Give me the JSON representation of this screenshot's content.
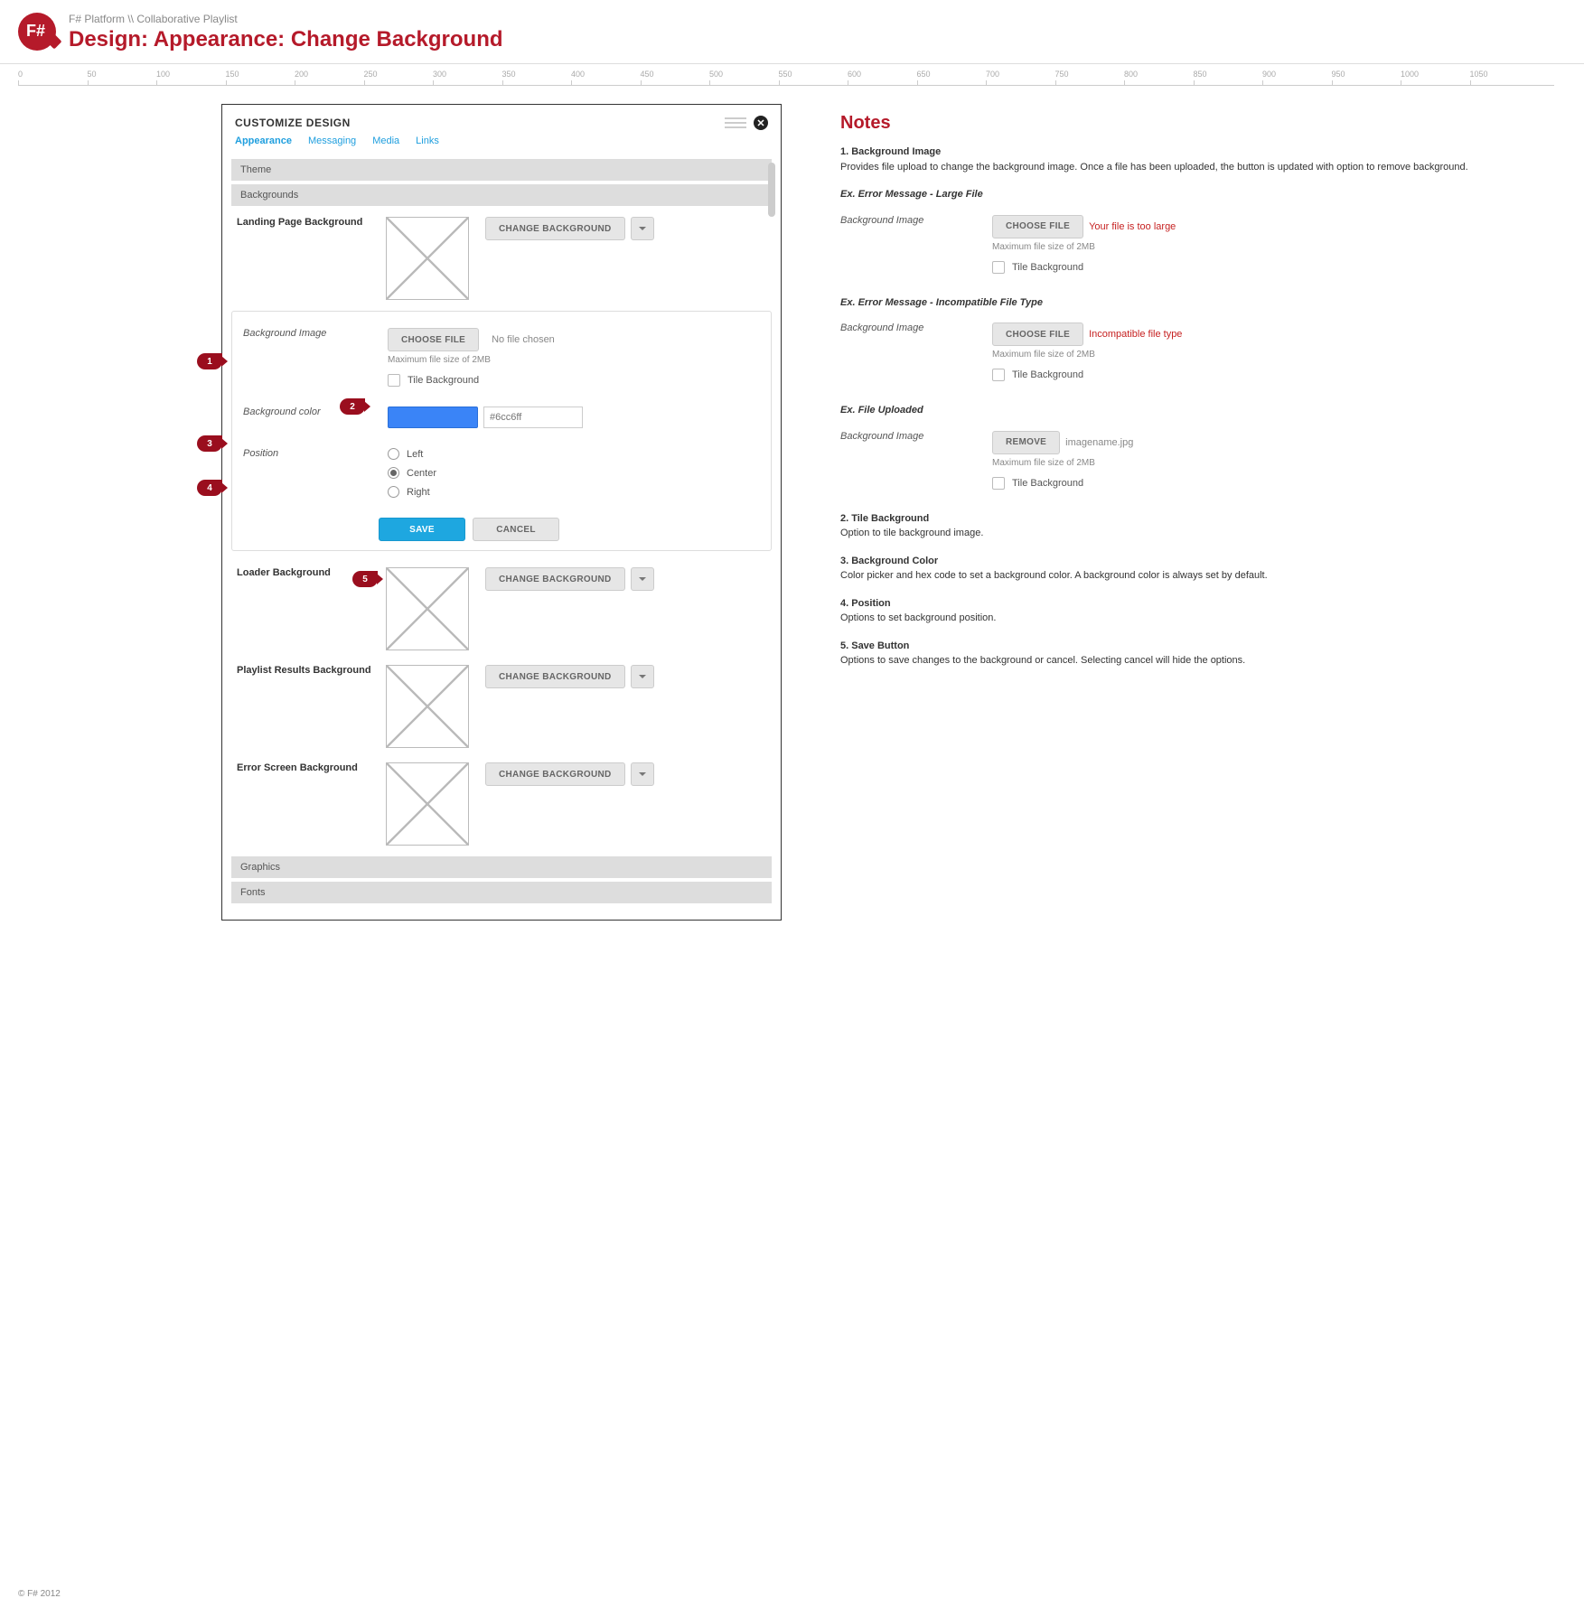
{
  "header": {
    "breadcrumb": "F# Platform \\\\ Collaborative Playlist",
    "title": "Design: Appearance: Change Background",
    "logo_text": "F#"
  },
  "ruler": {
    "ticks": [
      "0",
      "50",
      "100",
      "150",
      "200",
      "250",
      "300",
      "350",
      "400",
      "450",
      "500",
      "550",
      "600",
      "650",
      "700",
      "750",
      "800",
      "850",
      "900",
      "950",
      "1000",
      "1050"
    ]
  },
  "panel": {
    "title": "CUSTOMIZE DESIGN",
    "tabs": [
      {
        "label": "Appearance",
        "active": true
      },
      {
        "label": "Messaging",
        "active": false
      },
      {
        "label": "Media",
        "active": false
      },
      {
        "label": "Links",
        "active": false
      }
    ],
    "sections": {
      "theme": "Theme",
      "backgrounds": "Backgrounds",
      "graphics": "Graphics",
      "fonts": "Fonts"
    },
    "rows": {
      "landing": {
        "label": "Landing Page Background",
        "btn": "CHANGE BACKGROUND"
      },
      "loader": {
        "label": "Loader Background",
        "btn": "CHANGE BACKGROUND"
      },
      "playlist": {
        "label": "Playlist Results Background",
        "btn": "CHANGE BACKGROUND"
      },
      "error": {
        "label": "Error Screen Background",
        "btn": "CHANGE BACKGROUND"
      }
    },
    "expanded": {
      "bg_image_label": "Background Image",
      "choose_file": "Choose File",
      "no_file": "No file chosen",
      "max_hint": "Maximum file size of 2MB",
      "tile_label": "Tile Background",
      "bg_color_label": "Background color",
      "hex_placeholder": "#6cc6ff",
      "position_label": "Position",
      "pos_left": "Left",
      "pos_center": "Center",
      "pos_right": "Right",
      "save": "SAVE",
      "cancel": "CANCEL"
    }
  },
  "markers": {
    "m1": "1",
    "m2": "2",
    "m3": "3",
    "m4": "4",
    "m5": "5"
  },
  "notes": {
    "title": "Notes",
    "n1_title": "1. Background Image",
    "n1_body": "Provides file upload to change the background image. Once a file has been uploaded, the button is updated with option to remove background.",
    "ex_large_title": "Ex. Error Message - Large File",
    "ex_large_label": "Background Image",
    "ex_large_btn": "Choose File",
    "ex_large_err": "Your file is too large",
    "ex_large_hint": "Maximum file size of 2MB",
    "ex_large_tile": "Tile Background",
    "ex_type_title": "Ex. Error Message - Incompatible File Type",
    "ex_type_label": "Background Image",
    "ex_type_btn": "Choose File",
    "ex_type_err": "Incompatible file type",
    "ex_type_hint": "Maximum file size of 2MB",
    "ex_type_tile": "Tile Background",
    "ex_up_title": "Ex. File Uploaded",
    "ex_up_label": "Background Image",
    "ex_up_btn": "Remove",
    "ex_up_file": "imagename.jpg",
    "ex_up_hint": "Maximum file size of 2MB",
    "ex_up_tile": "Tile Background",
    "n2_title": "2. Tile Background",
    "n2_body": "Option to tile background image.",
    "n3_title": "3. Background Color",
    "n3_body": "Color picker and hex code to set a background color. A background color is always set by default.",
    "n4_title": "4. Position",
    "n4_body": "Options to set background position.",
    "n5_title": "5. Save Button",
    "n5_body": "Options to save changes to the background or cancel. Selecting cancel will hide the options."
  },
  "footer": "© F# 2012"
}
